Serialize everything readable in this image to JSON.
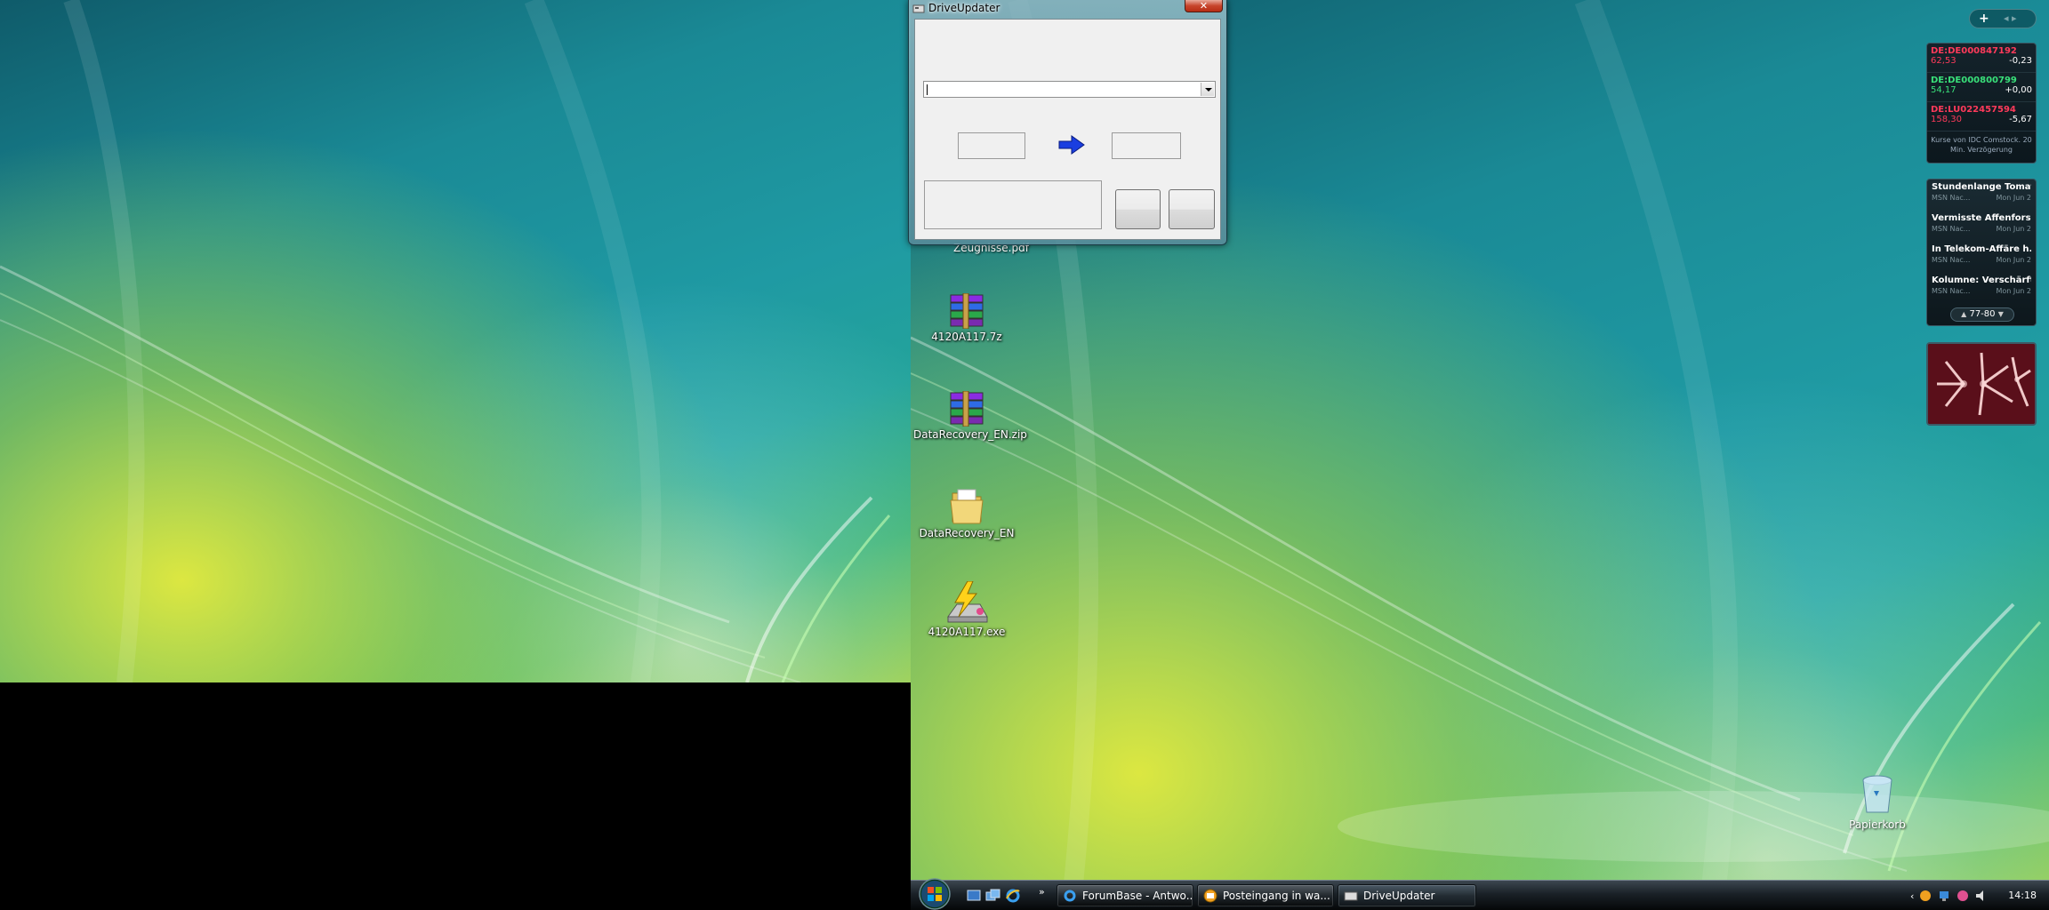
{
  "desktop": {
    "icons": [
      {
        "label": "4120A117.7z",
        "icon": "winrar-archive-icon"
      },
      {
        "label": "DataRecovery_EN.zip",
        "icon": "winrar-archive-icon"
      },
      {
        "label": "DataRecovery_EN",
        "icon": "folder-icon"
      },
      {
        "label": "4120A117.exe",
        "icon": "flash-installer-icon"
      }
    ],
    "partial_icon_label": "Zeugnisse.pdf",
    "recycle_bin_label": "Papierkorb"
  },
  "window": {
    "title": "DriveUpdater",
    "close_glyph": "✕",
    "combo_value": ""
  },
  "taskbar": {
    "quicklaunch_more": "»",
    "tasks": [
      {
        "label": "ForumBase - Antwo...",
        "icon": "ie-icon",
        "active": false
      },
      {
        "label": "Posteingang in wa...",
        "icon": "mail-icon",
        "active": false
      },
      {
        "label": "DriveUpdater",
        "icon": "app-icon",
        "active": true
      }
    ],
    "tray_chevron": "‹",
    "clock": "14:18"
  },
  "sidebar": {
    "add_glyph": "+",
    "nav_glyph": "◂ ▸",
    "stocks": [
      {
        "name": "DE:DE000847192",
        "price": "62,53",
        "change": "-0,23",
        "color": "#ff3a5a"
      },
      {
        "name": "DE:DE000800799",
        "price": "54,17",
        "change": "+0,00",
        "color": "#39e07a"
      },
      {
        "name": "DE:LU022457594",
        "price": "158,30",
        "change": "-5,67",
        "color": "#ff3a5a"
      }
    ],
    "stocks_footer": "Kurse von IDC Comstock. 20 Min. Verzögerung",
    "news": [
      {
        "title": "Stundenlange Tomat...",
        "source": "MSN Nac...",
        "date": "Mon Jun 2"
      },
      {
        "title": "Vermisste Affenforsc...",
        "source": "MSN Nac...",
        "date": "Mon Jun 2"
      },
      {
        "title": "In Telekom-Affäre h...",
        "source": "MSN Nac...",
        "date": "Mon Jun 2"
      },
      {
        "title": "Kolumne: Verschärft...",
        "source": "MSN Nac...",
        "date": "Mon Jun 2"
      }
    ],
    "news_pager": "77-80",
    "pager_up": "▲",
    "pager_down": "▼"
  }
}
